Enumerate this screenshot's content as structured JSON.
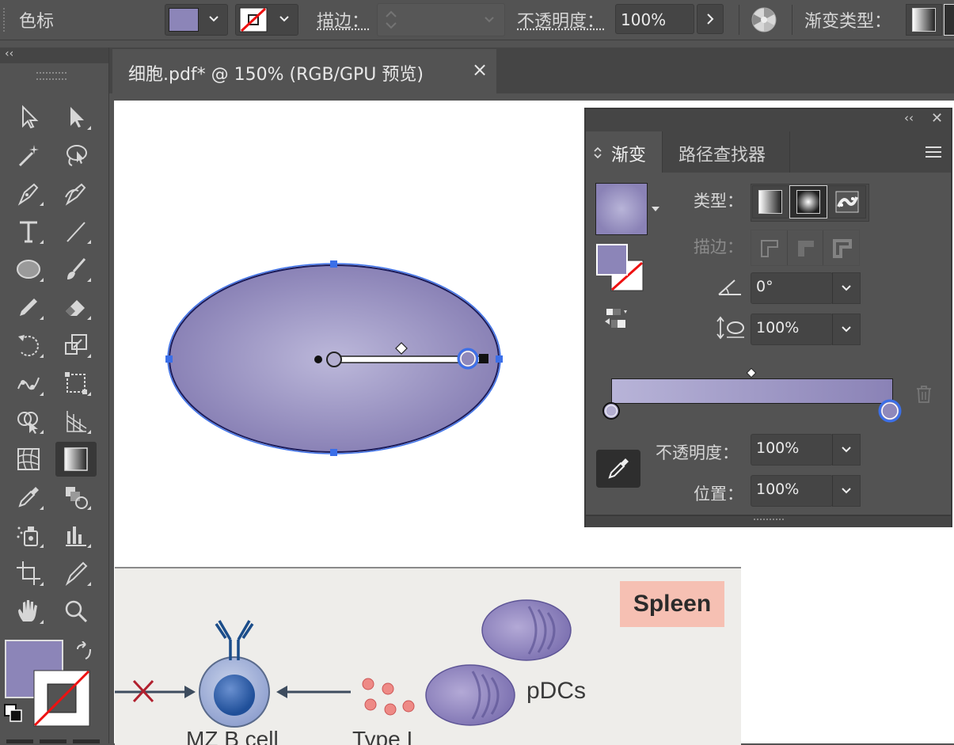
{
  "control_bar": {
    "label_color": "色标",
    "fill_color": "#8c85b8",
    "stroke_label": "描边：",
    "opacity_label": "不透明度：",
    "opacity_value": "100%",
    "gradient_type_label": "渐变类型："
  },
  "tab": {
    "title": "细胞.pdf* @ 150% (RGB/GPU 预览)",
    "close": "×"
  },
  "toolbar": {
    "collapse": "‹‹",
    "fill_color": "#8c85b8"
  },
  "gradient_panel": {
    "collapse": "‹‹",
    "close": "✕",
    "tab_gradient": "渐变",
    "tab_pathfinder": "路径查找器",
    "type_label": "类型：",
    "stroke_label": "描边：",
    "angle_value": "0°",
    "aspect_value": "100%",
    "opacity_label": "不透明度：",
    "opacity_value": "100%",
    "location_label": "位置：",
    "location_value": "100%",
    "gradient_start": "#b8b4d8",
    "gradient_end": "#8a82b6",
    "stop_start_color": "#b3aed0",
    "stop_end_color": "#8f88bb"
  },
  "artwork": {
    "ellipse_center_color": "#bcb8da",
    "ellipse_edge_color": "#8a82b6",
    "selection_color": "#3b6fe8"
  },
  "bottom_image": {
    "badge": "Spleen",
    "pdcs_label": "pDCs",
    "mzb_label": "MZ B cell",
    "type_label": "Type I"
  }
}
